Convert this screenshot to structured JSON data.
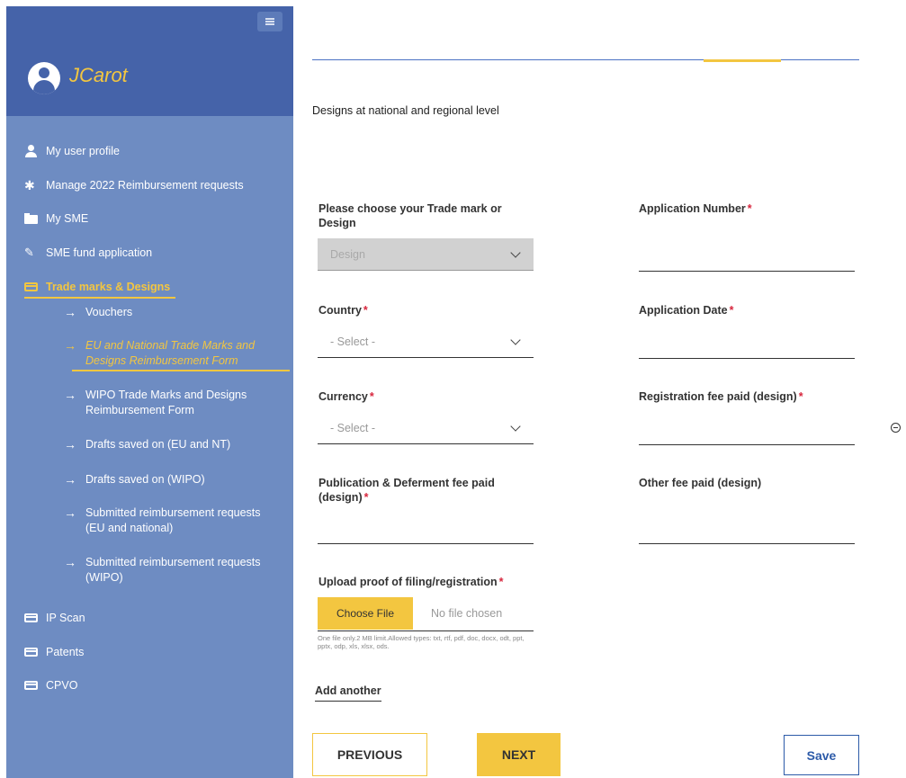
{
  "sidebar": {
    "username": "JCarot",
    "items": [
      {
        "label": "My user profile",
        "icon": "user-icon"
      },
      {
        "label": "Manage 2022 Reimbursement requests",
        "icon": "gear-icon"
      },
      {
        "label": "My SME",
        "icon": "folder-icon"
      },
      {
        "label": "SME fund application",
        "icon": "edit-icon"
      },
      {
        "label": "Trade marks & Designs",
        "icon": "card-icon"
      },
      {
        "label": "IP Scan",
        "icon": "card-icon"
      },
      {
        "label": "Patents",
        "icon": "card-icon"
      },
      {
        "label": "CPVO",
        "icon": "card-icon"
      }
    ],
    "subitems": [
      {
        "label": "Vouchers"
      },
      {
        "label": "EU and National Trade Marks and Designs Reimbursement Form"
      },
      {
        "label": "WIPO Trade Marks and Designs Reimbursement Form"
      },
      {
        "label": "Drafts saved on (EU and NT)"
      },
      {
        "label": "Drafts saved on (WIPO)"
      },
      {
        "label": "Submitted reimbursement requests (EU and national)"
      },
      {
        "label": "Submitted reimbursement requests (WIPO)"
      }
    ],
    "accent_color": "#f3c640"
  },
  "main": {
    "section_title": "Designs at national and regional level",
    "fields": {
      "trademark_design": {
        "label": "Please choose your Trade mark or Design",
        "value": "Design"
      },
      "application_number": {
        "label": "Application Number",
        "required": "*"
      },
      "country": {
        "label": "Country",
        "required": "*",
        "value": "- Select -"
      },
      "application_date": {
        "label": "Application Date",
        "required": "*"
      },
      "currency": {
        "label": "Currency",
        "required": "*",
        "value": "- Select -"
      },
      "registration_fee": {
        "label": "Registration fee paid (design)",
        "required": "*"
      },
      "publication_fee": {
        "label": "Publication & Deferment fee paid (design)",
        "required": "*"
      },
      "other_fee": {
        "label": "Other fee paid (design)"
      },
      "upload": {
        "label": "Upload proof of filing/registration",
        "required": "*",
        "button": "Choose File",
        "status": "No file chosen",
        "help": "One file only.2 MB limit.Allowed types: txt, rtf, pdf, doc, docx, odt, ppt, pptx, odp, xls, xlsx, ods."
      }
    },
    "add_another": "Add another",
    "buttons": {
      "previous": "PREVIOUS",
      "next": "NEXT",
      "save": "Save"
    }
  }
}
